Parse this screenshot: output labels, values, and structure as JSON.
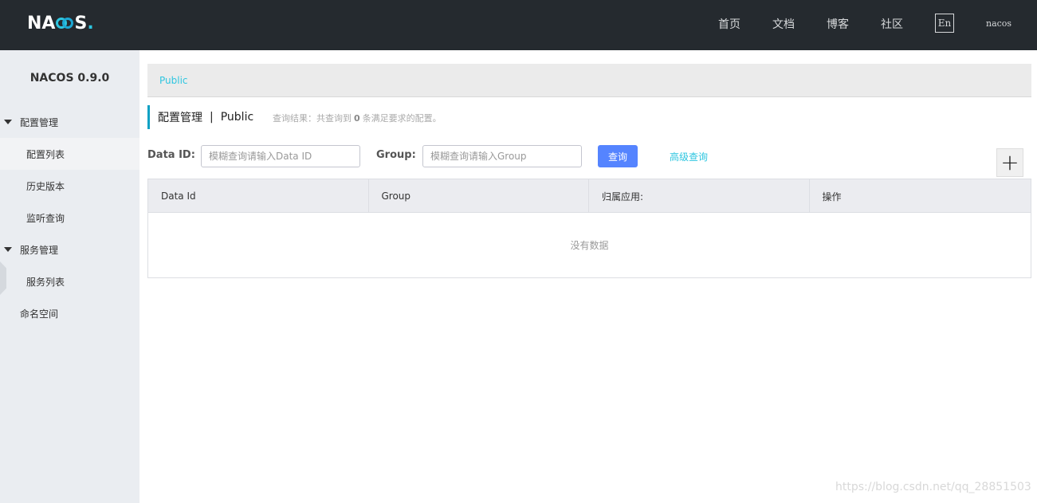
{
  "header": {
    "logo_text": {
      "pre": "NA",
      "post": "S",
      "dot": "."
    },
    "nav": [
      {
        "label": "首页"
      },
      {
        "label": "文档"
      },
      {
        "label": "博客"
      },
      {
        "label": "社区"
      }
    ],
    "lang_button": "En",
    "user": "nacos",
    "background_color": "#252a2f"
  },
  "sidebar": {
    "title": "NACOS 0.9.0",
    "groups": [
      {
        "label": "配置管理",
        "items": [
          {
            "label": "配置列表",
            "active": true
          },
          {
            "label": "历史版本"
          },
          {
            "label": "监听查询"
          }
        ]
      },
      {
        "label": "服务管理",
        "items": [
          {
            "label": "服务列表"
          }
        ]
      }
    ],
    "plain_items": [
      {
        "label": "命名空间"
      }
    ]
  },
  "breadcrumb": {
    "namespace": "Public"
  },
  "page": {
    "title": "配置管理",
    "separator": "|",
    "namespace": "Public",
    "result_prefix": "查询结果：共查询到",
    "result_count": "0",
    "result_suffix": "条满足要求的配置。"
  },
  "filters": {
    "data_id_label": "Data ID:",
    "data_id_placeholder": "模糊查询请输入Data ID",
    "group_label": "Group:",
    "group_placeholder": "模糊查询请输入Group",
    "query_button": "查询",
    "advanced_query": "高级查询",
    "add_button": "+"
  },
  "table": {
    "columns": [
      "Data Id",
      "Group",
      "归属应用:",
      "操作"
    ],
    "rows": [],
    "empty_text": "没有数据"
  },
  "watermark": "https://blog.csdn.net/qq_28851503",
  "colors": {
    "accent": "#2ec6e0",
    "primary_button": "#5584ff",
    "sidebar_bg": "#eaedf1"
  }
}
